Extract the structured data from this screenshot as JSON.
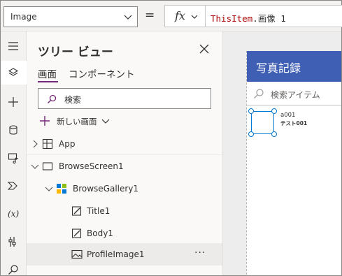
{
  "formula_bar": {
    "property": "Image",
    "equals": "=",
    "fx_label": "fx",
    "formula_keyword": "ThisItem",
    "formula_rest": ".画像 1"
  },
  "tree_view": {
    "title": "ツリー ビュー",
    "tabs": [
      "画面",
      "コンポーネント"
    ],
    "active_tab": "画面",
    "search_placeholder": "検索",
    "new_screen_label": "新しい画面",
    "nodes": [
      {
        "label": "App",
        "icon": "app-icon",
        "expander": "collapsed"
      },
      {
        "label": "BrowseScreen1",
        "icon": "screen-icon",
        "expander": "expanded"
      },
      {
        "label": "BrowseGallery1",
        "icon": "gallery-icon",
        "expander": "expanded"
      },
      {
        "label": "Title1",
        "icon": "edit-text-icon"
      },
      {
        "label": "Body1",
        "icon": "edit-text-icon"
      },
      {
        "label": "ProfileImage1",
        "icon": "image-icon",
        "selected": true,
        "more": "···"
      }
    ]
  },
  "canvas": {
    "app_title": "写真記録",
    "search_placeholder": "検索アイテム",
    "item_title": "a001",
    "item_body": "テスト001"
  },
  "colors": {
    "accent": "#742774",
    "app_header": "#3f5fb5",
    "selection": "#0078d4",
    "formula_keyword": "#a80000"
  }
}
